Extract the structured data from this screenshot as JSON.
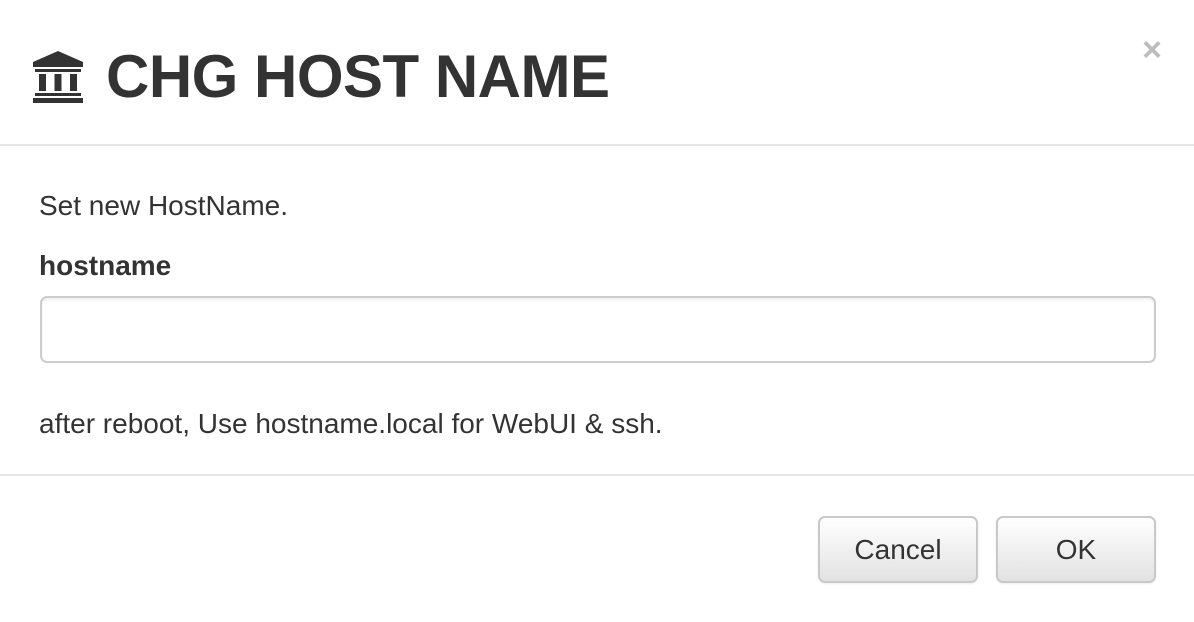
{
  "dialog": {
    "title": "CHG HOST NAME",
    "title_icon": "bank-icon",
    "close_label": "×",
    "close_icon": "close-icon"
  },
  "body": {
    "intro": "Set new HostName.",
    "field_label": "hostname",
    "field_value": "",
    "field_placeholder": "",
    "hint": "after reboot, Use hostname.local for WebUI & ssh."
  },
  "footer": {
    "cancel_label": "Cancel",
    "ok_label": "OK"
  },
  "colors": {
    "text": "#333333",
    "divider": "#e5e5e5",
    "close": "#bdbdbd",
    "input_border": "#cccccc"
  }
}
